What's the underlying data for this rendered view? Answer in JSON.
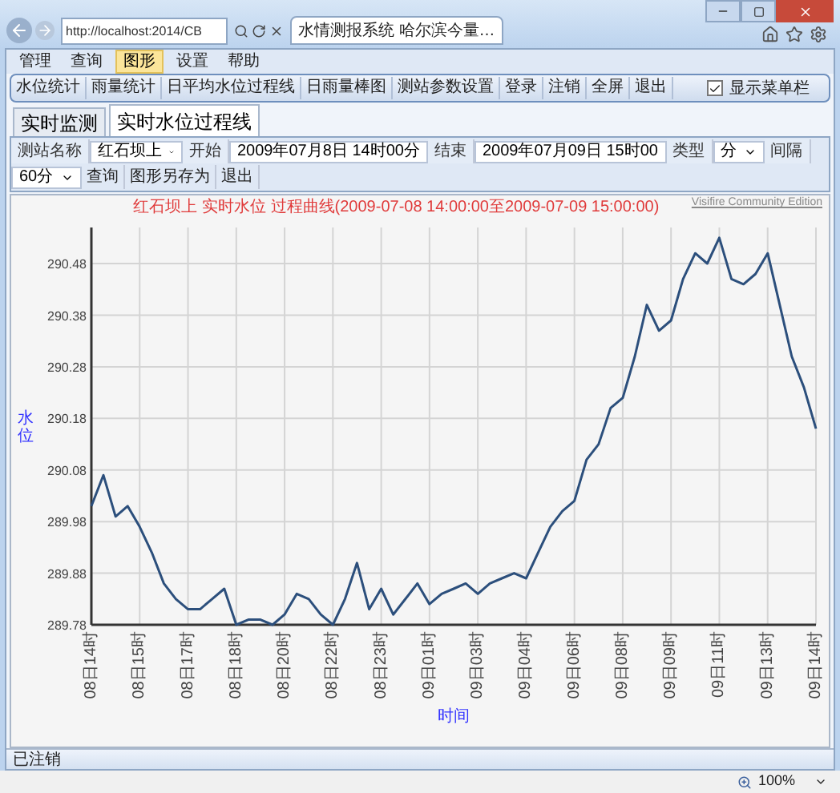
{
  "browser": {
    "address": "http://localhost:2014/CB",
    "tab_title": "水情测报系统 哈尔滨今量…"
  },
  "menu_bar": [
    {
      "label": "管理",
      "selected": false
    },
    {
      "label": "查询",
      "selected": false
    },
    {
      "label": "图形",
      "selected": true
    },
    {
      "label": "设置",
      "selected": false
    },
    {
      "label": "帮助",
      "selected": false
    }
  ],
  "toolbar": {
    "items": [
      "水位统计",
      "雨量统计",
      "日平均水位过程线",
      "日雨量棒图",
      "测站参数设置",
      "登录",
      "注销",
      "全屏",
      "退出"
    ],
    "checkbox": {
      "label": "显示菜单栏",
      "checked": true
    }
  },
  "tabs": [
    {
      "label": "实时监测",
      "selected": false
    },
    {
      "label": "实时水位过程线",
      "selected": true
    }
  ],
  "query_bar": {
    "station_label": "测站名称",
    "station_value": "红石坝上",
    "start_label": "开始",
    "start_value": "2009年07月8日 14时00分",
    "end_label": "结束",
    "end_value": "2009年07月09日 15时00",
    "type_label": "类型",
    "type_value": "分",
    "interval_label": "间隔",
    "interval_value": "60分",
    "buttons": [
      "查询",
      "图形另存为",
      "退出"
    ]
  },
  "chart_panel": {
    "watermark": "Visifire Community Edition",
    "chart_data": {
      "type": "line",
      "title": "红石坝上 实时水位 过程曲线(2009-07-08 14:00:00至2009-07-09 15:00:00)",
      "xlabel": "时间",
      "ylabel": "水位",
      "categories": [
        "08日14时",
        null,
        null,
        null,
        "08日15时",
        null,
        null,
        null,
        "08日17时",
        null,
        null,
        null,
        "08日18时",
        null,
        null,
        null,
        "08日20时",
        null,
        null,
        null,
        "08日22时",
        null,
        null,
        null,
        "08日23时",
        null,
        null,
        null,
        "09日01时",
        null,
        null,
        null,
        "09日03时",
        null,
        null,
        null,
        "09日04时",
        null,
        null,
        null,
        "09日06时",
        null,
        null,
        null,
        "09日08时",
        null,
        null,
        null,
        "09日09时",
        null,
        null,
        null,
        "09日11时",
        null,
        null,
        null,
        "09日13时",
        null,
        null,
        null,
        "09日14时"
      ],
      "series": [
        {
          "color": "#2c4f7c",
          "values": [
            290.01,
            290.07,
            289.99,
            290.01,
            289.97,
            289.92,
            289.86,
            289.83,
            289.81,
            289.81,
            289.83,
            289.85,
            289.78,
            289.79,
            289.79,
            289.78,
            289.8,
            289.84,
            289.83,
            289.8,
            289.78,
            289.83,
            289.9,
            289.81,
            289.85,
            289.8,
            289.83,
            289.86,
            289.82,
            289.84,
            289.85,
            289.86,
            289.84,
            289.86,
            289.87,
            289.88,
            289.87,
            289.92,
            289.97,
            290.0,
            290.02,
            290.1,
            290.13,
            290.2,
            290.22,
            290.3,
            290.4,
            290.35,
            290.37,
            290.45,
            290.5,
            290.48,
            290.53,
            290.45,
            290.44,
            290.46,
            290.5,
            290.4,
            290.3,
            290.24,
            290.16
          ]
        }
      ],
      "ylim": [
        289.78,
        290.55
      ],
      "grid": true,
      "yticks": [
        {
          "value": 289.78,
          "label": "289.78"
        },
        {
          "value": 289.88,
          "label": "289.88"
        },
        {
          "value": 289.98,
          "label": "289.98"
        },
        {
          "value": 290.08,
          "label": "290.08"
        },
        {
          "value": 290.18,
          "label": "290.18"
        },
        {
          "value": 290.28,
          "label": "290.28"
        },
        {
          "value": 290.38,
          "label": "290.38"
        },
        {
          "value": 290.48,
          "label": "290.48"
        }
      ]
    }
  },
  "status_bar": {
    "text": "已注销"
  },
  "browser_status": {
    "zoom": "100%"
  }
}
